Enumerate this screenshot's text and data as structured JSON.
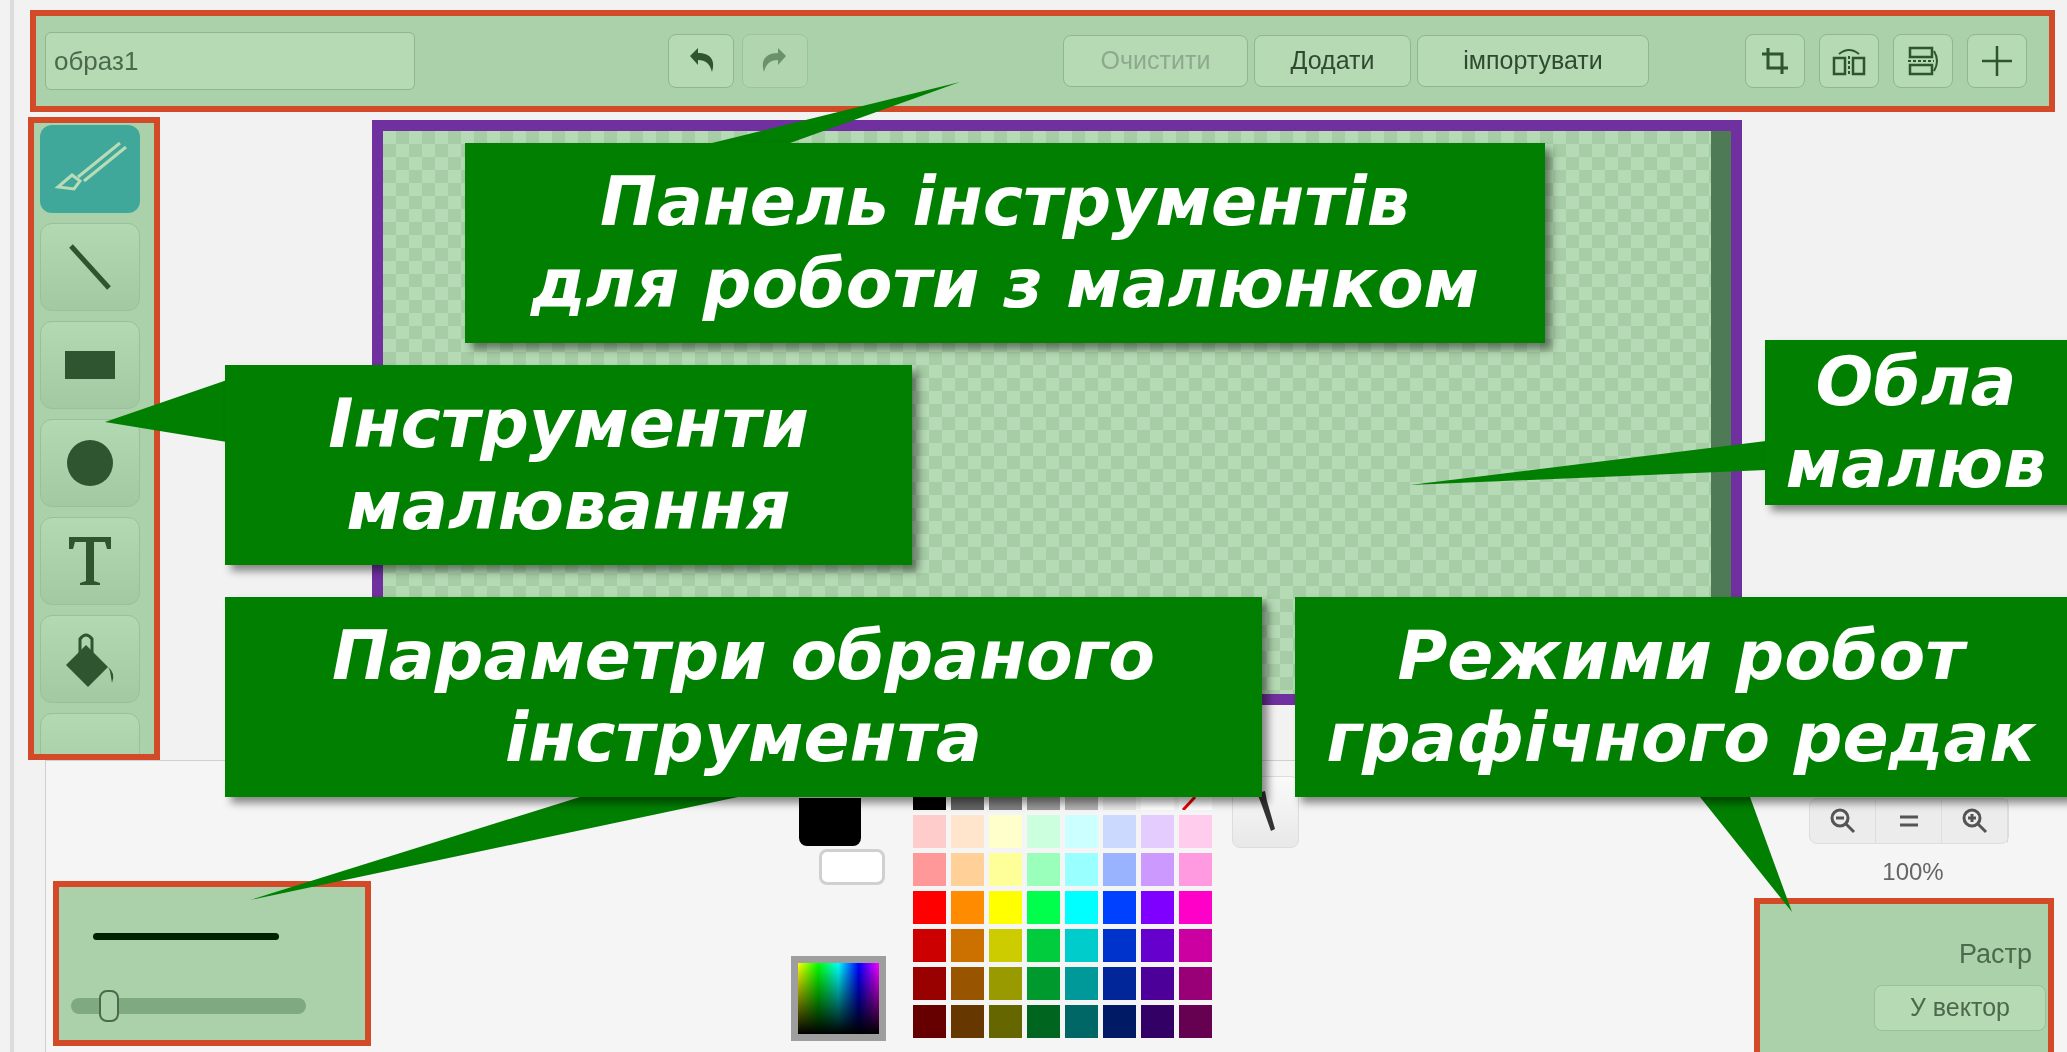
{
  "toolbar": {
    "name_field": {
      "value": "образ1"
    },
    "history_buttons": [
      {
        "kind": "undo",
        "disabled": false
      },
      {
        "kind": "redo",
        "disabled": true
      }
    ],
    "buttons": [
      {
        "label": "Очистити",
        "disabled": true
      },
      {
        "label": "Додати",
        "disabled": false
      },
      {
        "label": "імпортувати",
        "disabled": false
      }
    ],
    "tool_buttons": [
      {
        "kind": "crop"
      },
      {
        "kind": "flip-horizontal"
      },
      {
        "kind": "flip-vertical"
      },
      {
        "kind": "center"
      }
    ]
  },
  "tools": [
    {
      "kind": "brush",
      "selected": true
    },
    {
      "kind": "line",
      "selected": false
    },
    {
      "kind": "rectangle",
      "selected": false
    },
    {
      "kind": "ellipse",
      "selected": false
    },
    {
      "kind": "text",
      "selected": false
    },
    {
      "kind": "fill",
      "selected": false
    },
    {
      "kind": "other",
      "selected": false
    }
  ],
  "brush_settings": {
    "level": 0.13
  },
  "colors": {
    "current": [
      {
        "color": "#000000"
      },
      {
        "color": "#ffffff"
      }
    ],
    "palette": [
      [
        {
          "kind": "color",
          "color": "#000000"
        },
        {
          "kind": "color",
          "color": "#666666"
        },
        {
          "kind": "color",
          "color": "#808080"
        },
        {
          "kind": "color",
          "color": "#999999"
        },
        {
          "kind": "color",
          "color": "#b3b3b3"
        },
        {
          "kind": "color",
          "color": "#e6e6e6"
        },
        {
          "kind": "color",
          "color": "#ffffff"
        },
        {
          "kind": "none",
          "color": "#ffffff"
        }
      ],
      [
        {
          "kind": "color",
          "color": "#ffcccc"
        },
        {
          "kind": "color",
          "color": "#ffe5cc"
        },
        {
          "kind": "color",
          "color": "#ffffcc"
        },
        {
          "kind": "color",
          "color": "#ccffdd"
        },
        {
          "kind": "color",
          "color": "#ccffff"
        },
        {
          "kind": "color",
          "color": "#ccd9ff"
        },
        {
          "kind": "color",
          "color": "#e5ccff"
        },
        {
          "kind": "color",
          "color": "#ffccee"
        }
      ],
      [
        {
          "kind": "color",
          "color": "#ff9999"
        },
        {
          "kind": "color",
          "color": "#ffd199"
        },
        {
          "kind": "color",
          "color": "#ffff99"
        },
        {
          "kind": "color",
          "color": "#99ffbb"
        },
        {
          "kind": "color",
          "color": "#99ffff"
        },
        {
          "kind": "color",
          "color": "#99b3ff"
        },
        {
          "kind": "color",
          "color": "#cc99ff"
        },
        {
          "kind": "color",
          "color": "#ff99e0"
        }
      ],
      [
        {
          "kind": "color",
          "color": "#ff0000"
        },
        {
          "kind": "color",
          "color": "#ff8c00"
        },
        {
          "kind": "color",
          "color": "#ffff00"
        },
        {
          "kind": "color",
          "color": "#00ff4c"
        },
        {
          "kind": "color",
          "color": "#00ffff"
        },
        {
          "kind": "color",
          "color": "#0040ff"
        },
        {
          "kind": "color",
          "color": "#8000ff"
        },
        {
          "kind": "color",
          "color": "#ff00c8"
        }
      ],
      [
        {
          "kind": "color",
          "color": "#cc0000"
        },
        {
          "kind": "color",
          "color": "#cc7000"
        },
        {
          "kind": "color",
          "color": "#cccc00"
        },
        {
          "kind": "color",
          "color": "#00cc3d"
        },
        {
          "kind": "color",
          "color": "#00cccc"
        },
        {
          "kind": "color",
          "color": "#0033cc"
        },
        {
          "kind": "color",
          "color": "#6600cc"
        },
        {
          "kind": "color",
          "color": "#cc00a0"
        }
      ],
      [
        {
          "kind": "color",
          "color": "#990000"
        },
        {
          "kind": "color",
          "color": "#995400"
        },
        {
          "kind": "color",
          "color": "#999900"
        },
        {
          "kind": "color",
          "color": "#00992e"
        },
        {
          "kind": "color",
          "color": "#009999"
        },
        {
          "kind": "color",
          "color": "#002699"
        },
        {
          "kind": "color",
          "color": "#4c0099"
        },
        {
          "kind": "color",
          "color": "#990078"
        }
      ],
      [
        {
          "kind": "color",
          "color": "#660000"
        },
        {
          "kind": "color",
          "color": "#663800"
        },
        {
          "kind": "color",
          "color": "#666600"
        },
        {
          "kind": "color",
          "color": "#00661f"
        },
        {
          "kind": "color",
          "color": "#006666"
        },
        {
          "kind": "color",
          "color": "#001a66"
        },
        {
          "kind": "color",
          "color": "#330066"
        },
        {
          "kind": "color",
          "color": "#660050"
        }
      ]
    ]
  },
  "zoom": {
    "buttons": [
      {
        "kind": "zoom-out"
      },
      {
        "kind": "reset"
      },
      {
        "kind": "zoom-in"
      }
    ],
    "reading": "100%"
  },
  "modes": {
    "label": "Растр",
    "button": "У вектор"
  },
  "callouts": [
    {
      "lines": [
        "Панель інструментів",
        "для роботи з малюнком"
      ]
    },
    {
      "lines": [
        "Інструменти",
        "малювання"
      ]
    },
    {
      "lines": [
        "Обла",
        "малюв"
      ]
    },
    {
      "lines": [
        "Параметри обраного",
        "інструмента"
      ]
    },
    {
      "lines": [
        "Режими робот",
        "графічного редак"
      ]
    }
  ]
}
